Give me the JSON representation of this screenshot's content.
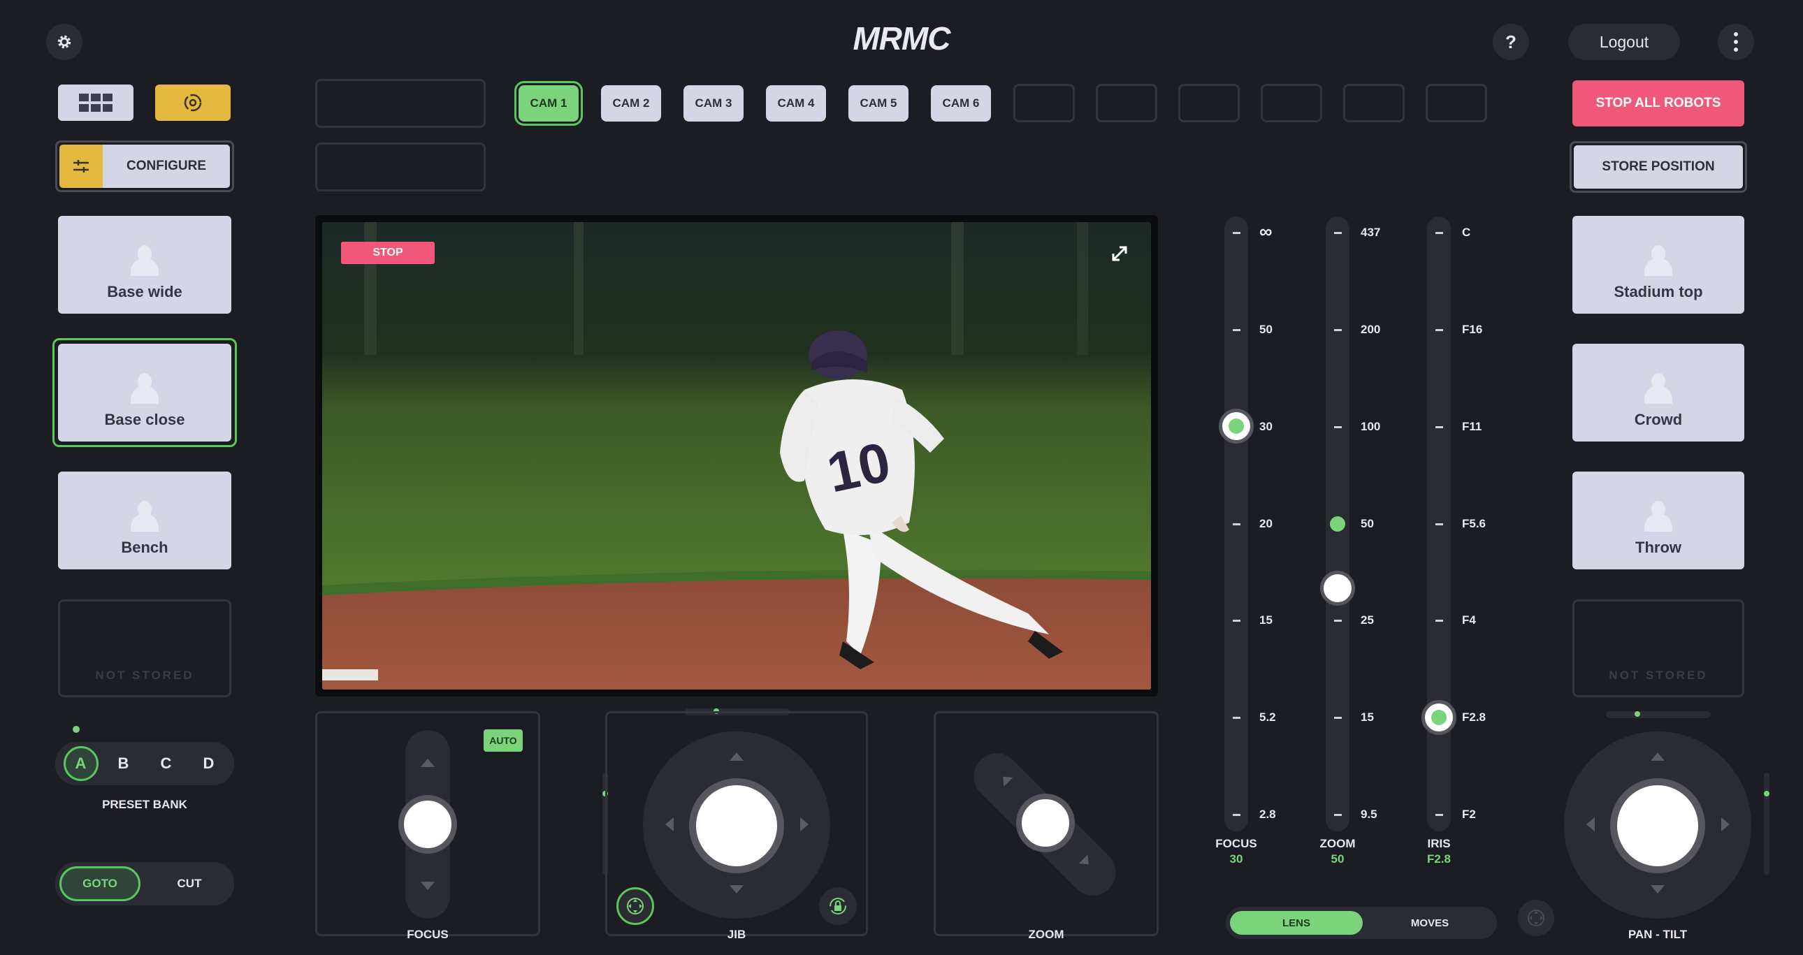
{
  "header": {
    "logo": "MRMC",
    "help_label": "?",
    "logout_label": "Logout",
    "stop_all_label": "STOP ALL ROBOTS",
    "store_position_label": "STORE POSITION",
    "configure_label": "CONFIGURE"
  },
  "cameras": [
    {
      "label": "CAM 1",
      "active": true
    },
    {
      "label": "CAM 2",
      "active": false
    },
    {
      "label": "CAM 3",
      "active": false
    },
    {
      "label": "CAM 4",
      "active": false
    },
    {
      "label": "CAM 5",
      "active": false
    },
    {
      "label": "CAM 6",
      "active": false
    }
  ],
  "left_presets": [
    {
      "label": "Base wide",
      "selected": false
    },
    {
      "label": "Base close",
      "selected": true
    },
    {
      "label": "Bench",
      "selected": false
    },
    {
      "label": "NOT STORED",
      "stored": false
    }
  ],
  "right_presets": [
    {
      "label": "Stadium top"
    },
    {
      "label": "Crowd"
    },
    {
      "label": "Throw"
    },
    {
      "label": "NOT STORED",
      "stored": false
    }
  ],
  "preset_bank": {
    "options": [
      "A",
      "B",
      "C",
      "D"
    ],
    "selected": "A",
    "label": "PRESET BANK"
  },
  "recall_mode": {
    "options": [
      "GOTO",
      "CUT"
    ],
    "selected": "GOTO"
  },
  "video": {
    "stop_label": "STOP",
    "jersey_number": "10"
  },
  "controls": {
    "focus_label": "FOCUS",
    "focus_auto_label": "AUTO",
    "jib_label": "JIB",
    "zoom_label": "ZOOM",
    "pan_tilt_label": "PAN - TILT"
  },
  "lens": {
    "sliders": [
      {
        "name": "FOCUS",
        "value": "30",
        "ticks": [
          "∞",
          "50",
          "30",
          "20",
          "15",
          "5.2",
          "2.8"
        ],
        "knob_level": 0.667,
        "target_level": null
      },
      {
        "name": "ZOOM",
        "value": "50",
        "ticks": [
          "437",
          "200",
          "100",
          "50",
          "25",
          "15",
          "9.5"
        ],
        "knob_level": 0.389,
        "target_level": 0.5
      },
      {
        "name": "IRIS",
        "value": "F2.8",
        "ticks": [
          "C",
          "F16",
          "F11",
          "F5.6",
          "F4",
          "F2.8",
          "F2"
        ],
        "knob_level": 0.167,
        "target_level": null
      }
    ],
    "mode_options": [
      "LENS",
      "MOVES"
    ],
    "mode_selected": "LENS"
  },
  "colors": {
    "accent_green": "#7bd47c",
    "stop_red": "#f0587a",
    "configure_yellow": "#e4b93f",
    "tile": "#d4d6e8",
    "background": "#1c1d23"
  }
}
